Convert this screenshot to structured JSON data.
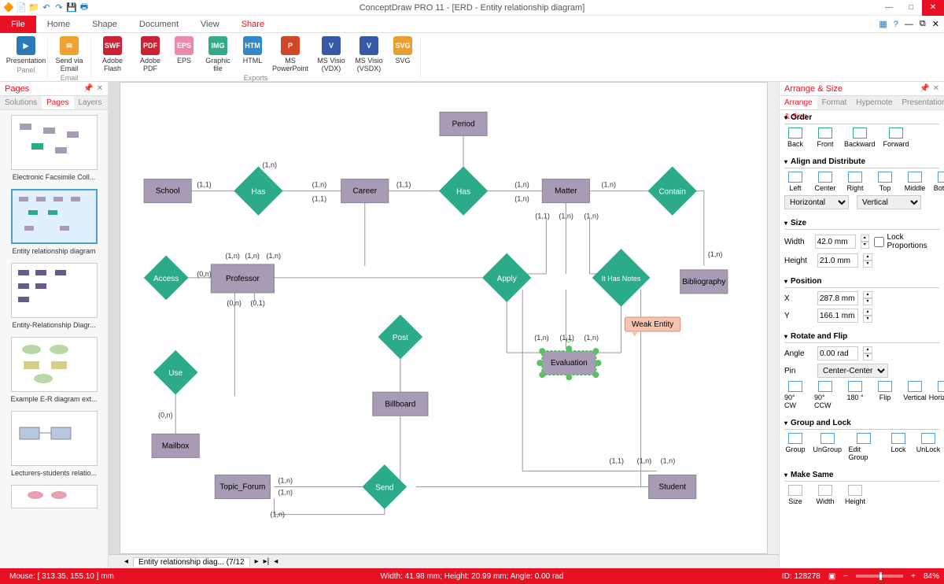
{
  "title": "ConceptDraw PRO 11 - [ERD - Entity relationship diagram]",
  "menu": {
    "file": "File",
    "home": "Home",
    "shape": "Shape",
    "document": "Document",
    "view": "View",
    "share": "Share"
  },
  "ribbon": {
    "panel_group": "Panel",
    "email_group": "Email",
    "exports_group": "Exports",
    "presentation": "Presentation",
    "send_email": "Send via Email",
    "adobe_flash": "Adobe Flash",
    "adobe_pdf": "Adobe PDF",
    "eps": "EPS",
    "graphic": "Graphic file",
    "html": "HTML",
    "ppt": "MS PowerPoint",
    "visio_vdx": "MS Visio (VDX)",
    "visio_vsdx": "MS Visio (VSDX)",
    "svg": "SVG"
  },
  "left": {
    "title": "Pages",
    "tab_solutions": "Solutions",
    "tab_pages": "Pages",
    "tab_layers": "Layers",
    "thumbs": [
      "Electronic Facsimile Coll...",
      "Entity relationship diagram",
      "Entity-Relationship Diagr...",
      "Example E-R diagram ext...",
      "Lecturers-students relatio..."
    ]
  },
  "diagram": {
    "entities": {
      "school": "School",
      "career": "Career",
      "period": "Period",
      "matter": "Matter",
      "bibliography": "Bibliography",
      "professor": "Professor",
      "access": "Access",
      "billboard": "Billboard",
      "mailbox": "Mailbox",
      "topic_forum": "Topic_Forum",
      "student": "Student",
      "evaluation": "Evaluation"
    },
    "relations": {
      "has1": "Has",
      "has2": "Has",
      "contain": "Contain",
      "apply": "Apply",
      "ithasnotes": "It Has Notes",
      "use": "Use",
      "post": "Post",
      "send": "Send"
    },
    "weak_entity": "Weak Entity",
    "cardinality": "(1,1)"
  },
  "right": {
    "title": "Arrange & Size",
    "tabs": {
      "arrange": "Arrange & Size",
      "format": "Format",
      "hypernote": "Hypernote",
      "presentation": "Presentation"
    },
    "order": {
      "head": "Order",
      "back": "Back",
      "front": "Front",
      "backward": "Backward",
      "forward": "Forward"
    },
    "align": {
      "head": "Align and Distribute",
      "left": "Left",
      "center": "Center",
      "right": "Right",
      "top": "Top",
      "middle": "Middle",
      "bottom": "Bottom",
      "horizontal": "Horizontal",
      "vertical": "Vertical"
    },
    "size": {
      "head": "Size",
      "width_l": "Width",
      "width_v": "42.0 mm",
      "height_l": "Height",
      "height_v": "21.0 mm",
      "lock": "Lock Proportions"
    },
    "pos": {
      "head": "Position",
      "x_l": "X",
      "x_v": "287.8 mm",
      "y_l": "Y",
      "y_v": "166.1 mm"
    },
    "rotate": {
      "head": "Rotate and Flip",
      "angle_l": "Angle",
      "angle_v": "0.00 rad",
      "pin_l": "Pin",
      "pin_v": "Center-Center",
      "cw": "90° CW",
      "ccw": "90° CCW",
      "r180": "180 °",
      "flip": "Flip",
      "vertical": "Vertical",
      "horizontal": "Horizontal"
    },
    "group": {
      "head": "Group and Lock",
      "group": "Group",
      "ungroup": "UnGroup",
      "edit": "Edit Group",
      "lock": "Lock",
      "unlock": "UnLock"
    },
    "same": {
      "head": "Make Same",
      "size": "Size",
      "width": "Width",
      "height": "Height"
    }
  },
  "canvas_tab": {
    "name": "Entity relationship diag...",
    "count": "(7/12"
  },
  "status": {
    "mouse": "Mouse: [ 313.35, 155.10 ] mm",
    "dims": "Width: 41.98 mm;  Height: 20.99 mm;  Angle: 0.00 rad",
    "id": "ID: 128278",
    "zoom": "84%"
  }
}
